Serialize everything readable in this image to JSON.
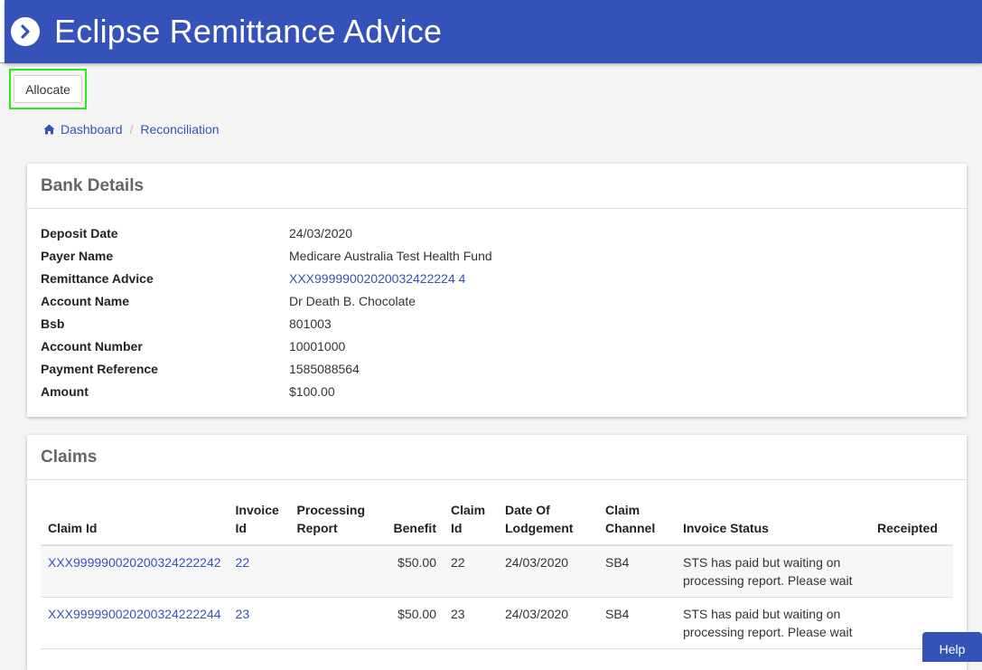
{
  "header": {
    "title": "Eclipse Remittance Advice"
  },
  "toolbar": {
    "allocate_label": "Allocate"
  },
  "breadcrumb": {
    "home": "Dashboard",
    "current": "Reconciliation"
  },
  "bank_details": {
    "heading": "Bank Details",
    "rows": [
      {
        "label": "Deposit Date",
        "value": "24/03/2020"
      },
      {
        "label": "Payer Name",
        "value": "Medicare Australia Test Health Fund"
      },
      {
        "label": "Remittance Advice",
        "value": "XXX99999002020032422224 4"
      },
      {
        "label": "Account Name",
        "value": "Dr Death B. Chocolate"
      },
      {
        "label": "Bsb",
        "value": "801003"
      },
      {
        "label": "Account Number",
        "value": "10001000"
      },
      {
        "label": "Payment Reference",
        "value": "1585088564"
      },
      {
        "label": "Amount",
        "value": "$100.00"
      }
    ]
  },
  "claims": {
    "heading": "Claims",
    "columns": [
      "Claim Id",
      "Invoice Id",
      "Processing Report",
      "Benefit",
      "Claim Id",
      "Date Of Lodgement",
      "Claim Channel",
      "Invoice Status",
      "Receipted"
    ],
    "rows": [
      {
        "claim_id": "XXX999990020200324222242",
        "invoice_id": "22",
        "processing_report": "",
        "benefit": "$50.00",
        "claim_no": "22",
        "date": "24/03/2020",
        "channel": "SB4",
        "status": "STS has paid but waiting on processing report. Please wait",
        "receipted": ""
      },
      {
        "claim_id": "XXX999990020200324222244",
        "invoice_id": "23",
        "processing_report": "",
        "benefit": "$50.00",
        "claim_no": "23",
        "date": "24/03/2020",
        "channel": "SB4",
        "status": "STS has paid but waiting on processing report. Please wait",
        "receipted": ""
      }
    ]
  },
  "help": {
    "label": "Help"
  },
  "colors": {
    "brand": "#3552b8",
    "highlight": "#2ee81f"
  }
}
